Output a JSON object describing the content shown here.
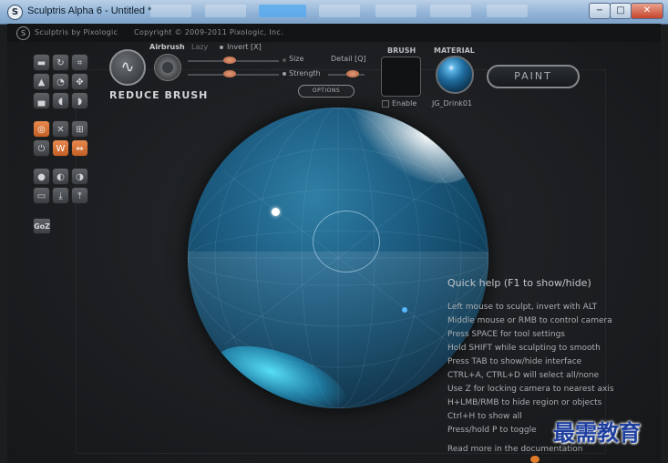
{
  "window": {
    "title": "Sculptris Alpha 6 - Untitled *",
    "controls": {
      "minimize": "−",
      "maximize": "□",
      "close": "✕"
    }
  },
  "header": {
    "brand": "Sculptris by Pixologic",
    "copyright": "Copyright © 2009-2011 Pixologic, Inc."
  },
  "brush": {
    "name": "REDUCE BRUSH",
    "airbrush_label": "Airbrush",
    "lazy_label": "Lazy",
    "invert_label": "Invert [X]",
    "size_label": "Size",
    "strength_label": "Strength",
    "detail_label": "Detail [Q]",
    "options_label": "OPTIONS",
    "section_title": "BRUSH",
    "enable_label": "Enable"
  },
  "material": {
    "section_title": "MATERIAL",
    "name": "JG_Drink01"
  },
  "paint_button": "PAINT",
  "goz_label": "GoZ",
  "quick_help": {
    "title": "Quick help (F1 to show/hide)",
    "lines": [
      "Left mouse to sculpt, invert with ALT",
      "Middle mouse or RMB to control camera",
      "Press SPACE for tool settings",
      "Hold SHIFT while sculpting to smooth",
      "Press TAB to show/hide interface",
      "CTRL+A, CTRL+D will select all/none",
      "Use Z for locking camera to nearest axis",
      "H+LMB/RMB to hide region or objects",
      "Ctrl+H to show all",
      "Press/hold P to toggle"
    ],
    "more": "Read more in the documentation"
  },
  "watermark": "最需教育",
  "colors": {
    "accent_orange": "#d9743a",
    "sphere_blue": "#1f6187",
    "titlebar": "#8fb2d6"
  }
}
